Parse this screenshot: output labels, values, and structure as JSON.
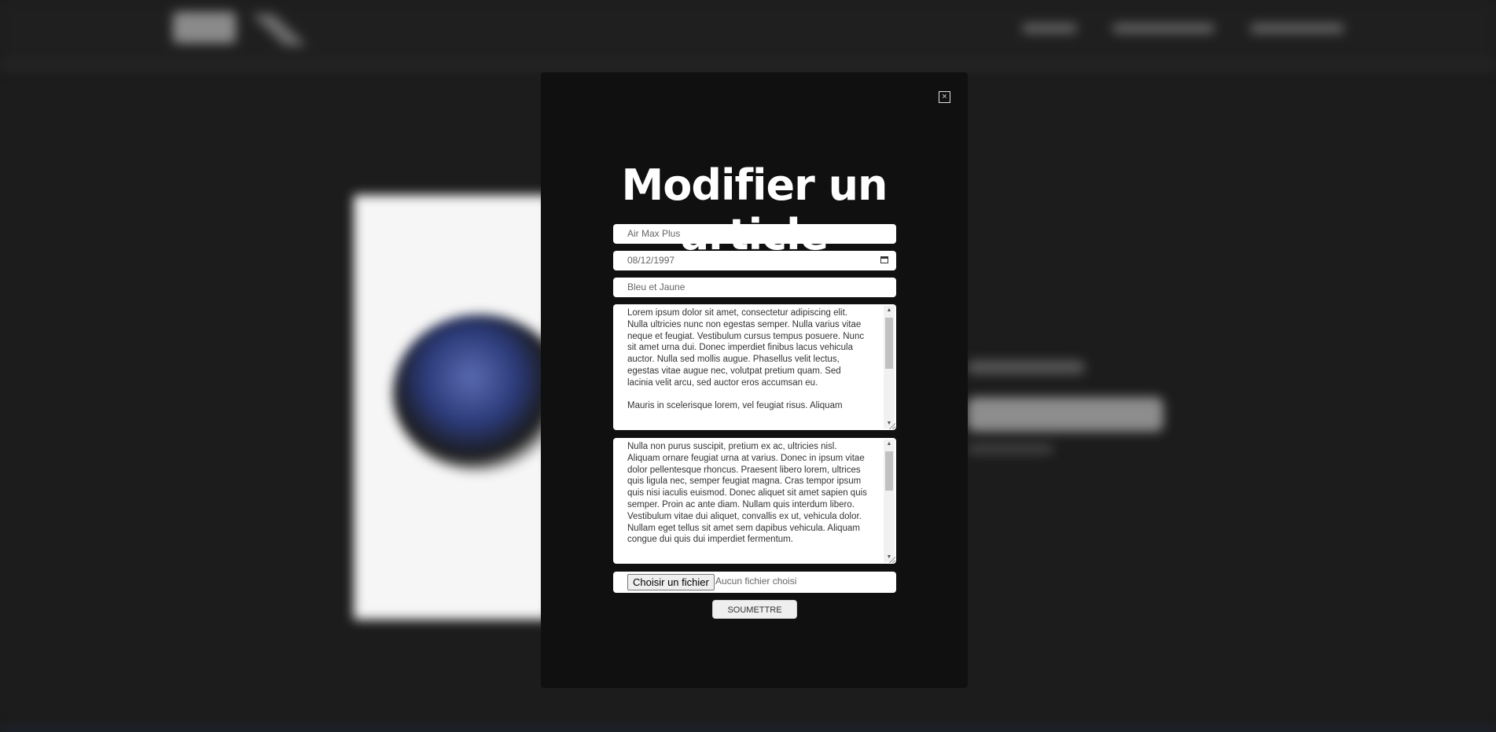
{
  "modal": {
    "title": "Modifier un article",
    "close_icon": "×"
  },
  "form": {
    "name_value": "Air Max Plus",
    "date_value": "08/12/1997",
    "color_value": "Bleu et Jaune",
    "description_value": "Lorem ipsum dolor sit amet, consectetur adipiscing elit. Nulla ultricies nunc non egestas semper. Nulla varius vitae neque et feugiat. Vestibulum cursus tempus posuere. Nunc sit amet urna dui. Donec imperdiet finibus lacus vehicula auctor. Nulla sed mollis augue. Phasellus velit lectus, egestas vitae augue nec, volutpat pretium quam. Sed lacinia velit arcu, sed auctor eros accumsan eu.\n\nMauris in scelerisque lorem, vel feugiat risus. Aliquam",
    "details_value": "Nulla non purus suscipit, pretium ex ac, ultricies nisl. Aliquam ornare feugiat urna at varius. Donec in ipsum vitae dolor pellentesque rhoncus. Praesent libero lorem, ultrices quis ligula nec, semper feugiat magna. Cras tempor ipsum quis nisi iaculis euismod. Donec aliquet sit amet sapien quis semper. Proin ac ante diam. Nullam quis interdum libero. Vestibulum vitae dui aliquet, convallis ex ut, vehicula dolor. Nullam eget tellus sit amet sem dapibus vehicula. Aliquam congue dui quis dui imperdiet fermentum.",
    "file_button_label": "Choisir un fichier",
    "file_status": "Aucun fichier choisi",
    "submit_label": "SOUMETTRE"
  }
}
